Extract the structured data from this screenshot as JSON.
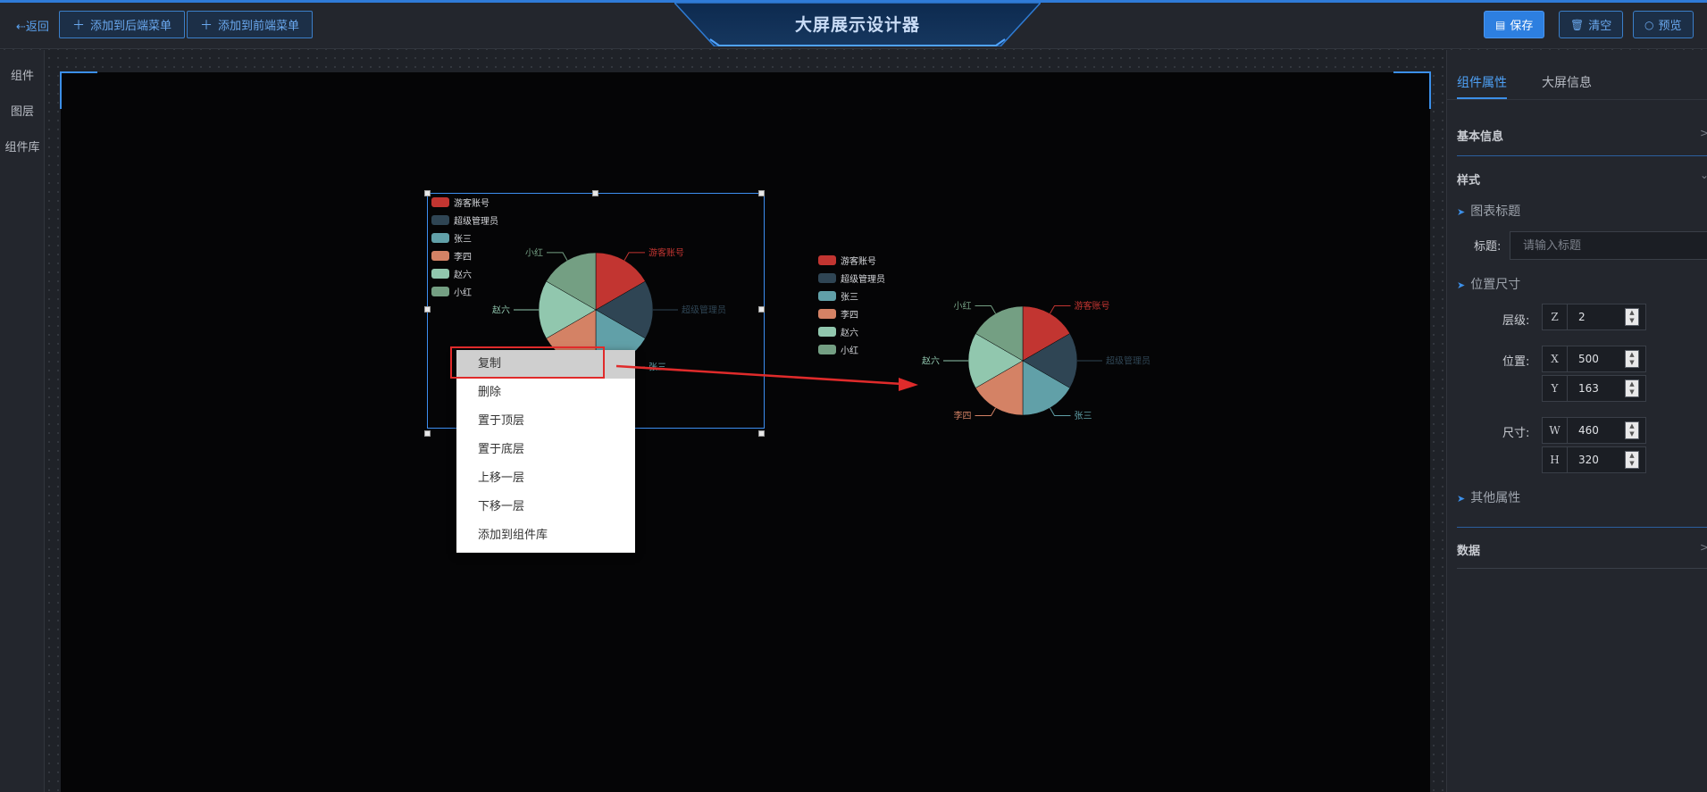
{
  "topbar": {
    "back_label": "⇠返回",
    "add_back_menu": "添加到后端菜单",
    "add_front_menu": "添加到前端菜单",
    "title": "大屏展示设计器",
    "save_label": "保存",
    "clear_label": "清空",
    "preview_label": "预览"
  },
  "sidebar": {
    "items": [
      {
        "label": "组件"
      },
      {
        "label": "图层"
      },
      {
        "label": "组件库"
      }
    ]
  },
  "chart_data": [
    {
      "type": "pie",
      "categories": [
        "游客账号",
        "超级管理员",
        "张三",
        "李四",
        "赵六",
        "小红"
      ],
      "values": [
        1,
        1,
        1,
        1,
        1,
        1
      ],
      "colors": [
        "#c23531",
        "#2f4554",
        "#61a0a8",
        "#d48265",
        "#91c7ae",
        "#749f83"
      ],
      "legend_position": "top-left"
    },
    {
      "type": "pie",
      "categories": [
        "游客账号",
        "超级管理员",
        "张三",
        "李四",
        "赵六",
        "小红"
      ],
      "values": [
        1,
        1,
        1,
        1,
        1,
        1
      ],
      "colors": [
        "#c23531",
        "#2f4554",
        "#61a0a8",
        "#d48265",
        "#91c7ae",
        "#749f83"
      ],
      "legend_position": "left"
    }
  ],
  "context_menu": {
    "items": [
      {
        "label": "复制",
        "active": true
      },
      {
        "label": "删除"
      },
      {
        "label": "置于顶层"
      },
      {
        "label": "置于底层"
      },
      {
        "label": "上移一层"
      },
      {
        "label": "下移一层"
      },
      {
        "label": "添加到组件库"
      }
    ]
  },
  "right_panel": {
    "tabs": [
      {
        "label": "组件属性",
        "active": true
      },
      {
        "label": "大屏信息"
      }
    ],
    "basic_info": "基本信息",
    "style": "样式",
    "chart_title_group": "图表标题",
    "title_label": "标题:",
    "title_placeholder": "请输入标题",
    "position_size_group": "位置尺寸",
    "level_label": "层级:",
    "position_label": "位置:",
    "size_label": "尺寸:",
    "z_prefix": "Z",
    "z_value": "2",
    "x_prefix": "X",
    "x_value": "500",
    "y_prefix": "Y",
    "y_value": "163",
    "w_prefix": "W",
    "w_value": "460",
    "h_prefix": "H",
    "h_value": "320",
    "other_props_group": "其他属性",
    "data_section": "数据"
  },
  "colors": {
    "accent": "#3c8fe8",
    "highlight_red": "#e02b2b"
  }
}
